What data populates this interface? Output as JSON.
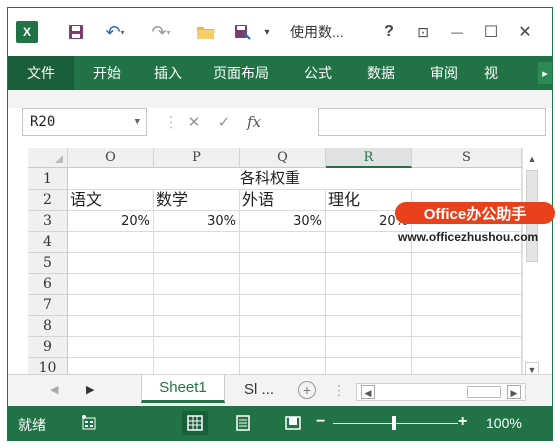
{
  "titlebar": {
    "app_icon": "excel-icon",
    "title": "使用数...",
    "help": "?",
    "restore_ribbon": "⊡",
    "minimize": "—",
    "maximize": "☐",
    "close": "✕"
  },
  "ribbon": {
    "tabs": [
      "文件",
      "开始",
      "插入",
      "页面布局",
      "公式",
      "数据",
      "审阅",
      "视"
    ]
  },
  "formula_bar": {
    "name_box": "R20",
    "cancel": "✕",
    "enter": "✓",
    "function": "fx",
    "content": ""
  },
  "sheet": {
    "columns": [
      "O",
      "P",
      "Q",
      "R",
      "S"
    ],
    "active_column": "R",
    "rows": [
      "1",
      "2",
      "3",
      "4",
      "5",
      "6",
      "7",
      "8",
      "9",
      "10"
    ],
    "title": "各科权重",
    "headers": [
      "语文",
      "数学",
      "外语",
      "理化"
    ],
    "values": [
      "20%",
      "30%",
      "30%",
      "20%"
    ]
  },
  "watermark": {
    "badge": "Office办公助手",
    "url": "www.officezhushou.com"
  },
  "sheet_tabs": {
    "active": "Sheet1",
    "next": "Sl ...",
    "add": "+"
  },
  "statusbar": {
    "ready": "就绪",
    "zoom_level": "100%",
    "zoom_fraction": 0.47,
    "minus": "−",
    "plus": "+"
  }
}
